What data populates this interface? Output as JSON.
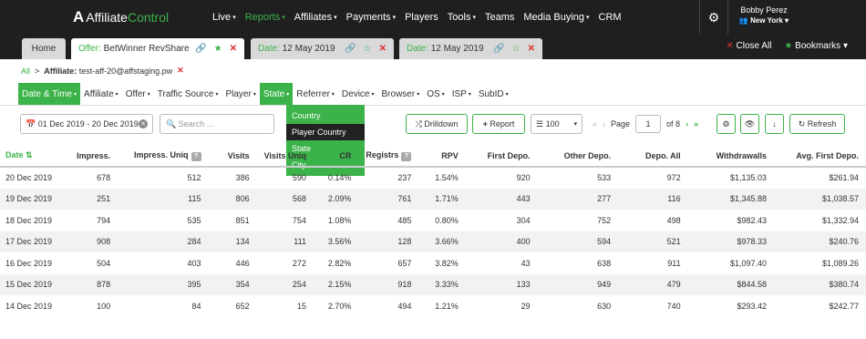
{
  "brand": {
    "mark": "A",
    "name_part1": "Affiliate",
    "name_part2": "Control"
  },
  "nav": [
    {
      "label": "Live",
      "caret": "▾",
      "active": false
    },
    {
      "label": "Reports",
      "caret": "▾",
      "active": true
    },
    {
      "label": "Affiliates",
      "caret": "▾",
      "active": false
    },
    {
      "label": "Payments",
      "caret": "▾",
      "active": false
    },
    {
      "label": "Players",
      "caret": "",
      "active": false
    },
    {
      "label": "Tools",
      "caret": "▾",
      "active": false
    },
    {
      "label": "Teams",
      "caret": "",
      "active": false
    },
    {
      "label": "Media Buying",
      "caret": "▾",
      "active": false
    },
    {
      "label": "CRM",
      "caret": "",
      "active": false
    }
  ],
  "user": {
    "name": "Bobby Perez",
    "timezone": "New York"
  },
  "tabs": {
    "home": "Home",
    "offer_prefix": "Offer:",
    "offer_value": "BetWinner RevShare",
    "date1_prefix": "Date:",
    "date1_value": "12 May 2019",
    "date2_prefix": "Date:",
    "date2_value": "12 May 2019",
    "close_all": "Close All",
    "bookmarks": "Bookmarks"
  },
  "breadcrumb": {
    "all": "All",
    "sep": ">",
    "filter_prefix": "Affiliate:",
    "filter_value": "test-aff-20@affstaging.pw"
  },
  "filterbar": [
    "Date & Time",
    "Affiliate",
    "Offer",
    "Traffic Source",
    "Player",
    "State",
    "Referrer",
    "Device",
    "Browser",
    "OS",
    "ISP",
    "SubID"
  ],
  "state_dropdown": [
    "Country",
    "Player Country",
    "State",
    "City"
  ],
  "controls": {
    "date_range": "01 Dec 2019 - 20 Dec 2019",
    "search_placeholder": "Search ...",
    "drilldown": "Drilldown",
    "report": "Report",
    "per_page": "100",
    "page_label": "Page",
    "page_value": "1",
    "page_of": "of 8",
    "refresh": "Refresh"
  },
  "table": {
    "headers": [
      "Date",
      "Impress.",
      "Impress. Uniq",
      "Visits",
      "Visits Uniq",
      "CR",
      "Registrs",
      "RPV",
      "First Depo.",
      "Other Depo.",
      "Depo. All",
      "Withdrawalls",
      "Avg. First Depo."
    ],
    "rows": [
      [
        "20 Dec 2019",
        "678",
        "512",
        "386",
        "590",
        "0.14%",
        "237",
        "1.54%",
        "920",
        "533",
        "972",
        "$1,135.03",
        "$261.94"
      ],
      [
        "19 Dec 2019",
        "251",
        "115",
        "806",
        "568",
        "2.09%",
        "761",
        "1.71%",
        "443",
        "277",
        "116",
        "$1,345.88",
        "$1,038.57"
      ],
      [
        "18 Dec 2019",
        "794",
        "535",
        "851",
        "754",
        "1.08%",
        "485",
        "0.80%",
        "304",
        "752",
        "498",
        "$982.43",
        "$1,332.94"
      ],
      [
        "17 Dec 2019",
        "908",
        "284",
        "134",
        "111",
        "3.56%",
        "128",
        "3.66%",
        "400",
        "594",
        "521",
        "$978.33",
        "$240.76"
      ],
      [
        "16 Dec 2019",
        "504",
        "403",
        "446",
        "272",
        "2.82%",
        "657",
        "3.82%",
        "43",
        "638",
        "911",
        "$1,097.40",
        "$1,089.26"
      ],
      [
        "15 Dec 2019",
        "878",
        "395",
        "354",
        "254",
        "2.15%",
        "918",
        "3.33%",
        "133",
        "949",
        "479",
        "$844.58",
        "$380.74"
      ],
      [
        "14 Dec 2019",
        "100",
        "84",
        "652",
        "15",
        "2.70%",
        "494",
        "1.21%",
        "29",
        "630",
        "740",
        "$293.42",
        "$242.77"
      ]
    ]
  },
  "colors": {
    "accent": "#3bb34a",
    "topbar": "#1f1f1f",
    "danger": "#e03030"
  }
}
